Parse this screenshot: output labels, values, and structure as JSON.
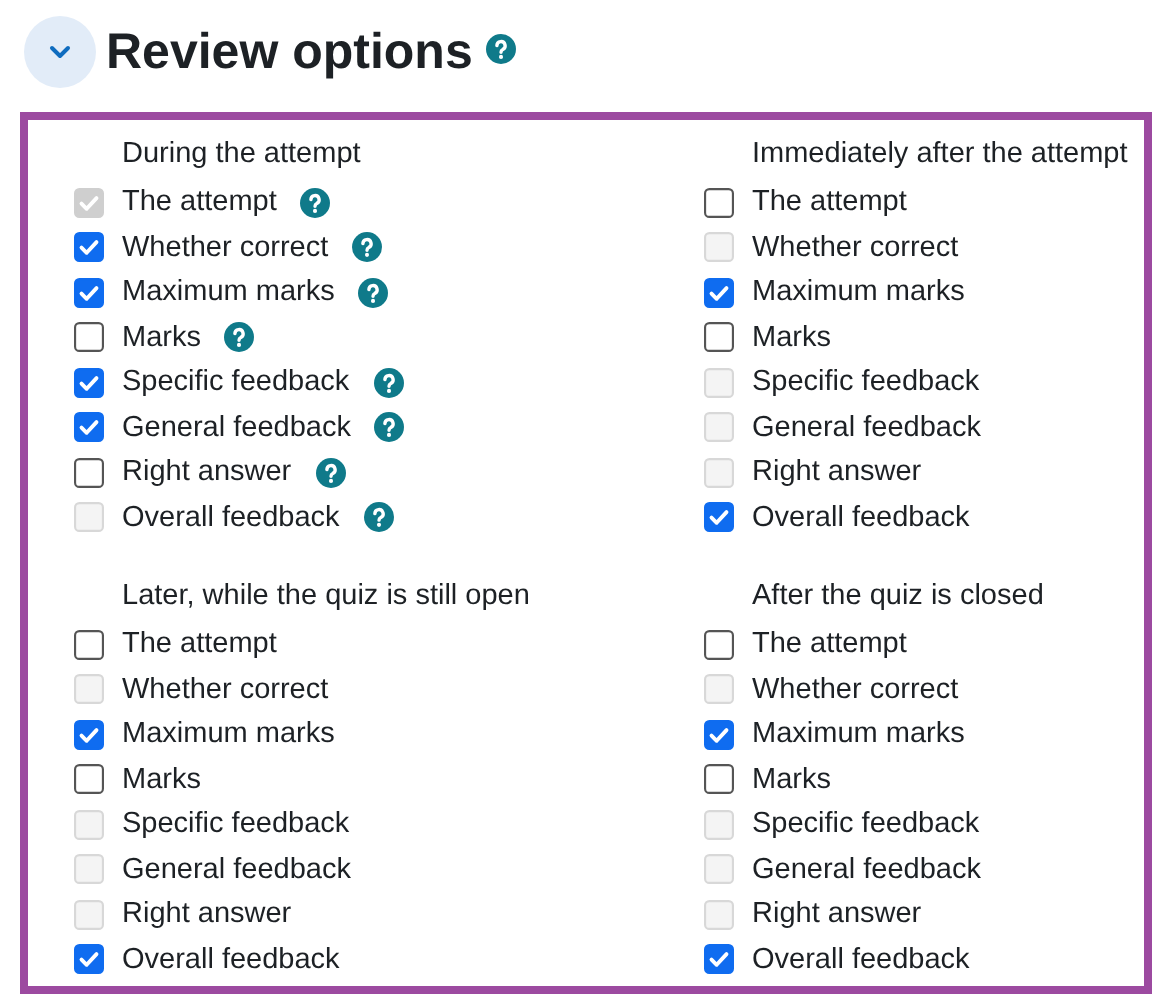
{
  "section": {
    "title": "Review options",
    "expanded": true,
    "help": true
  },
  "groups": [
    {
      "heading": "During the attempt",
      "options": [
        {
          "label": "The attempt",
          "checked": true,
          "disabled": true,
          "help": true
        },
        {
          "label": "Whether correct",
          "checked": true,
          "disabled": false,
          "help": true
        },
        {
          "label": "Maximum marks",
          "checked": true,
          "disabled": false,
          "help": true
        },
        {
          "label": "Marks",
          "checked": false,
          "disabled": false,
          "help": true
        },
        {
          "label": "Specific feedback",
          "checked": true,
          "disabled": false,
          "help": true
        },
        {
          "label": "General feedback",
          "checked": true,
          "disabled": false,
          "help": true
        },
        {
          "label": "Right answer",
          "checked": false,
          "disabled": false,
          "help": true
        },
        {
          "label": "Overall feedback",
          "checked": false,
          "disabled": true,
          "help": true
        }
      ]
    },
    {
      "heading": "Immediately after the attempt",
      "options": [
        {
          "label": "The attempt",
          "checked": false,
          "disabled": false,
          "help": false
        },
        {
          "label": "Whether correct",
          "checked": false,
          "disabled": true,
          "help": false
        },
        {
          "label": "Maximum marks",
          "checked": true,
          "disabled": false,
          "help": false
        },
        {
          "label": "Marks",
          "checked": false,
          "disabled": false,
          "help": false
        },
        {
          "label": "Specific feedback",
          "checked": false,
          "disabled": true,
          "help": false
        },
        {
          "label": "General feedback",
          "checked": false,
          "disabled": true,
          "help": false
        },
        {
          "label": "Right answer",
          "checked": false,
          "disabled": true,
          "help": false
        },
        {
          "label": "Overall feedback",
          "checked": true,
          "disabled": false,
          "help": false
        }
      ]
    },
    {
      "heading": "Later, while the quiz is still open",
      "options": [
        {
          "label": "The attempt",
          "checked": false,
          "disabled": false,
          "help": false
        },
        {
          "label": "Whether correct",
          "checked": false,
          "disabled": true,
          "help": false
        },
        {
          "label": "Maximum marks",
          "checked": true,
          "disabled": false,
          "help": false
        },
        {
          "label": "Marks",
          "checked": false,
          "disabled": false,
          "help": false
        },
        {
          "label": "Specific feedback",
          "checked": false,
          "disabled": true,
          "help": false
        },
        {
          "label": "General feedback",
          "checked": false,
          "disabled": true,
          "help": false
        },
        {
          "label": "Right answer",
          "checked": false,
          "disabled": true,
          "help": false
        },
        {
          "label": "Overall feedback",
          "checked": true,
          "disabled": false,
          "help": false
        }
      ]
    },
    {
      "heading": "After the quiz is closed",
      "options": [
        {
          "label": "The attempt",
          "checked": false,
          "disabled": false,
          "help": false
        },
        {
          "label": "Whether correct",
          "checked": false,
          "disabled": true,
          "help": false
        },
        {
          "label": "Maximum marks",
          "checked": true,
          "disabled": false,
          "help": false
        },
        {
          "label": "Marks",
          "checked": false,
          "disabled": false,
          "help": false
        },
        {
          "label": "Specific feedback",
          "checked": false,
          "disabled": true,
          "help": false
        },
        {
          "label": "General feedback",
          "checked": false,
          "disabled": true,
          "help": false
        },
        {
          "label": "Right answer",
          "checked": false,
          "disabled": true,
          "help": false
        },
        {
          "label": "Overall feedback",
          "checked": true,
          "disabled": false,
          "help": false
        }
      ]
    }
  ]
}
